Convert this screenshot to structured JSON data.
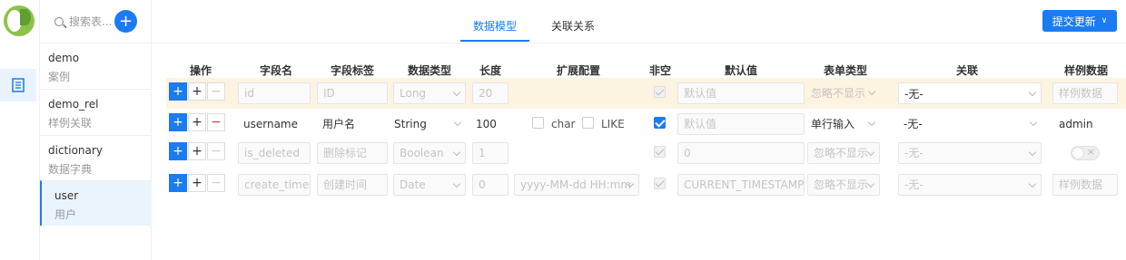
{
  "sidebar": {
    "search_placeholder": "搜索表...",
    "add_label": "+",
    "entities": [
      {
        "name": "demo",
        "desc": "案例"
      },
      {
        "name": "demo_rel",
        "desc": "样例关联"
      },
      {
        "name": "dictionary",
        "desc": "数据字典"
      },
      {
        "name": "user",
        "desc": "用户"
      }
    ]
  },
  "tabs": [
    "数据模型",
    "关联关系"
  ],
  "submit": {
    "label": "提交更新",
    "chevron": "∨"
  },
  "table": {
    "headers": [
      "操作",
      "字段名",
      "字段标签",
      "数据类型",
      "长度",
      "扩展配置",
      "非空",
      "默认值",
      "表单类型",
      "关联",
      "样例数据"
    ],
    "ops": {
      "add": "+",
      "insert": "+",
      "remove": "−"
    },
    "rows": [
      {
        "field": "id",
        "label": "ID",
        "type": "Long",
        "length": "20",
        "ext": "",
        "notnull": true,
        "default": "默认值",
        "form": "忽略不显示",
        "rel": "-无-",
        "sample": "样例数据"
      },
      {
        "field": "username",
        "label": "用户名",
        "type": "String",
        "length": "100",
        "ext_char": "char",
        "ext_like": "LIKE",
        "notnull": true,
        "default": "默认值",
        "form": "单行输入",
        "rel": "-无-",
        "sample": "admin"
      },
      {
        "field": "is_deleted",
        "label": "删除标记",
        "type": "Boolean",
        "length": "1",
        "ext": "",
        "notnull": true,
        "default": "0",
        "form": "忽略不显示",
        "rel": "-无-",
        "sample": ""
      },
      {
        "field": "create_time",
        "label": "创建时间",
        "type": "Date",
        "length": "0",
        "ext": "yyyy-MM-dd HH:mm",
        "notnull": true,
        "default": "CURRENT_TIMESTAMP",
        "form": "忽略不显示",
        "rel": "-无-",
        "sample": "样例数据"
      }
    ]
  },
  "colors": {
    "accent": "#1a7bf2",
    "highlight_row": "#fdf3e1",
    "danger": "#e53935"
  }
}
